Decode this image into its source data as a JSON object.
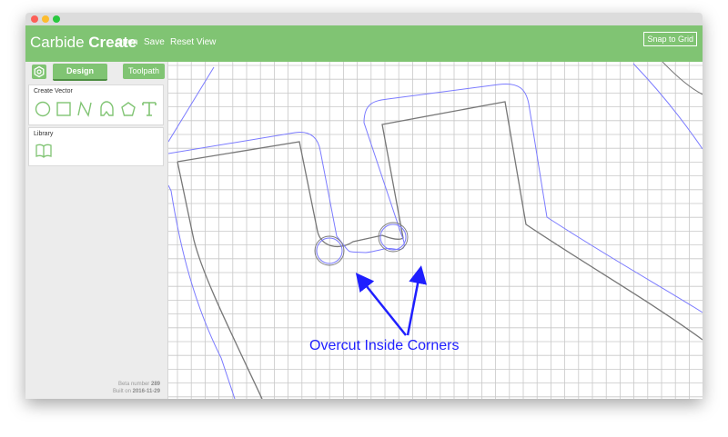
{
  "window": {
    "traffic_lights": [
      "close",
      "minimize",
      "zoom"
    ]
  },
  "appbar": {
    "brand_light": "Carbide",
    "brand_bold": "Create",
    "menu": [
      "Open",
      "Save",
      "Reset View"
    ],
    "snap_label": "Snap to Grid",
    "color": "#80c473"
  },
  "sidebar": {
    "settings_icon": "gear-icon",
    "tabs": [
      "Design",
      "Toolpath"
    ],
    "active_tab": "Design",
    "create_vector": {
      "title": "Create Vector",
      "tools": [
        "circle-icon",
        "rectangle-icon",
        "polyline-icon",
        "curve-icon",
        "polygon-icon",
        "text-icon"
      ]
    },
    "library": {
      "title": "Library",
      "icon": "book-icon"
    },
    "build": {
      "beta_prefix": "Beta number",
      "beta_number": "289",
      "built_prefix": "Built on",
      "built_date": "2016-11-29"
    }
  },
  "canvas": {
    "grid": true,
    "grid_color": "#c8c8c8",
    "shape_color": "#777777",
    "offset_color": "#7b7bff",
    "annotation_label": "Overcut Inside Corners",
    "annotation_color": "#1f1fff"
  }
}
